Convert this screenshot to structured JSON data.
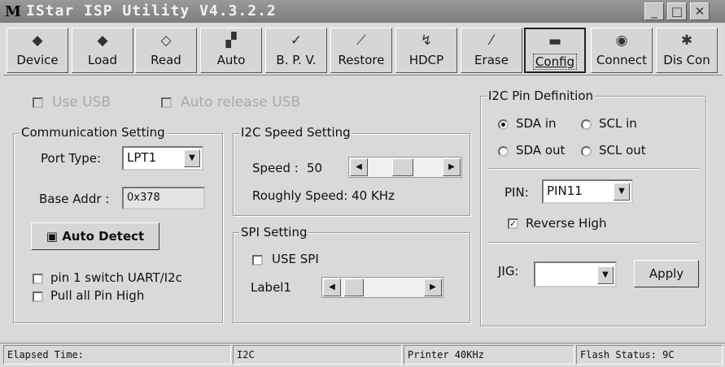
{
  "window": {
    "title": "IStar ISP Utility V4.3.2.2",
    "app_icon": "M",
    "controls": {
      "minimize": "_",
      "maximize": "□",
      "close": "✕"
    }
  },
  "toolbar": {
    "items": [
      {
        "label": "Device",
        "icon": "chip-icon"
      },
      {
        "label": "Load",
        "icon": "load-icon"
      },
      {
        "label": "Read",
        "icon": "read-icon"
      },
      {
        "label": "Auto",
        "icon": "auto-icon"
      },
      {
        "label": "B. P. V.",
        "icon": "bpv-icon"
      },
      {
        "label": "Restore",
        "icon": "restore-icon"
      },
      {
        "label": "HDCP",
        "icon": "hdcp-icon"
      },
      {
        "label": "Erase",
        "icon": "erase-icon"
      },
      {
        "label": "Config",
        "icon": "config-icon",
        "active": true
      },
      {
        "label": "Connect",
        "icon": "connect-icon"
      },
      {
        "label": "Dis Con",
        "icon": "disconnect-icon"
      }
    ]
  },
  "usb": {
    "use_usb": "Use USB",
    "auto_release": "Auto release USB"
  },
  "comm": {
    "legend": "Communication Setting",
    "port_label": "Port Type:",
    "port_value": "LPT1",
    "base_label": "Base Addr :",
    "base_value": "0x378",
    "auto_detect": "Auto Detect",
    "pin1_switch": "pin 1 switch UART/I2c",
    "pull_all": "Pull all Pin High"
  },
  "i2c_speed": {
    "legend": "I2C Speed Setting",
    "speed_label": "Speed :",
    "speed_value": "50",
    "roughly": "Roughly Speed: 40 KHz",
    "slider_fraction": 0.45
  },
  "spi": {
    "legend": "SPI Setting",
    "use_spi": "USE SPI",
    "label1": "Label1",
    "slider_fraction": 0.05
  },
  "pin_def": {
    "legend": "I2C Pin Definition",
    "sda_in": "SDA in",
    "scl_in": "SCL in",
    "sda_out": "SDA out",
    "scl_out": "SCL out",
    "selected": "SDA in",
    "pin_label": "PIN:",
    "pin_value": "PIN11",
    "reverse_high": "Reverse High",
    "reverse_checked": true,
    "jig_label": "JIG:",
    "jig_value": "",
    "apply": "Apply"
  },
  "status": {
    "elapsed": "Elapsed Time:",
    "mode": "I2C",
    "printer": "Printer  40KHz",
    "flash": "Flash Status: 9C"
  }
}
